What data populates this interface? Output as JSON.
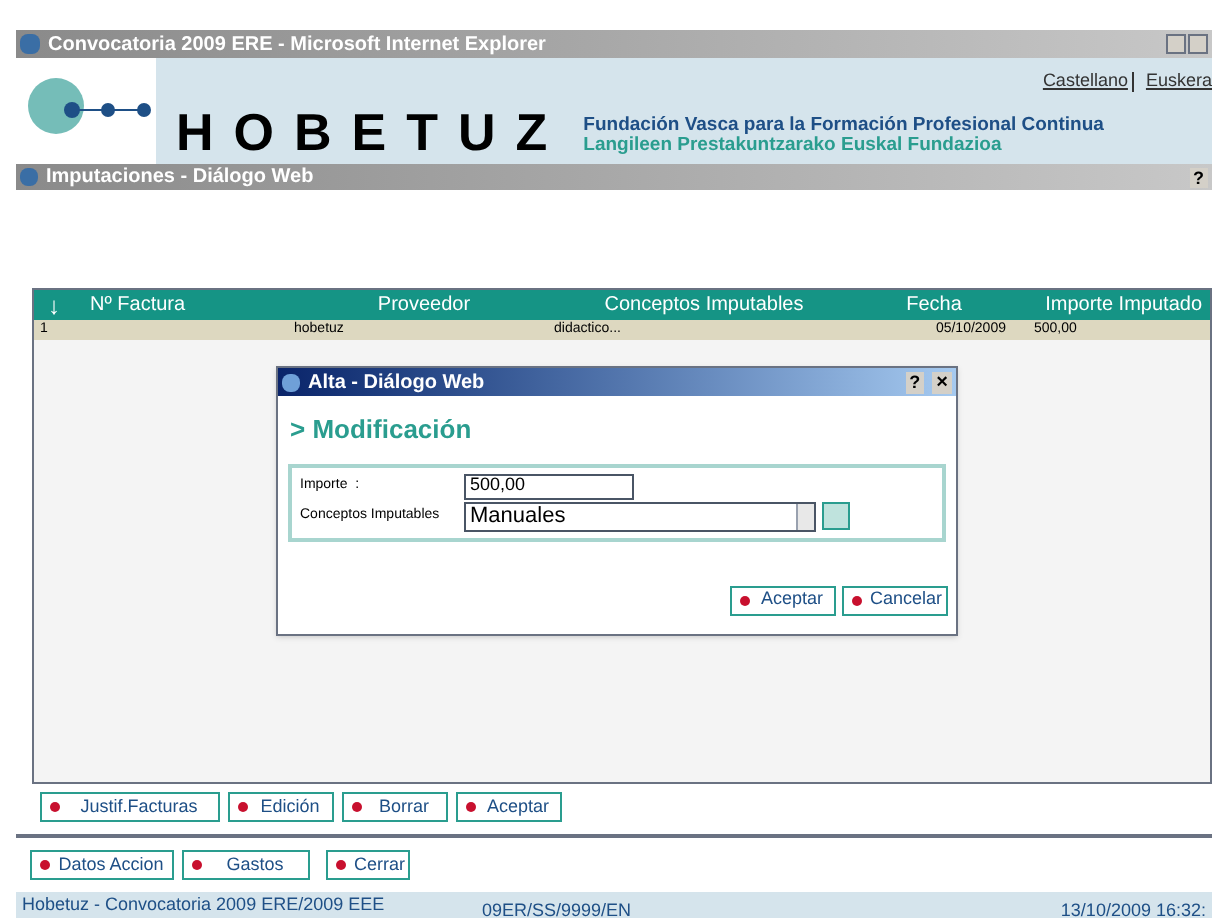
{
  "browser_window": {
    "title": "Convocatoria 2009 ERE - Microsoft Internet Explorer"
  },
  "header": {
    "languages": [
      "Castellano",
      "Euskera"
    ],
    "logo_text": "HOBETUZ",
    "tagline_es": "Fundación Vasca para la Formación Profesional Continua",
    "tagline_eu": "Langileen Prestakuntzarako Euskal Fundazioa"
  },
  "dialog_window": {
    "title": "Imputaciones - Diálogo Web",
    "help": "?"
  },
  "table": {
    "sort_icon": "↓",
    "columns": [
      "Nº Factura",
      "Proveedor",
      "Conceptos Imputables",
      "Fecha",
      "Importe Imputado"
    ],
    "rows": [
      {
        "cells": [
          "1",
          "hobetuz",
          "didactico...",
          "05/10/2009",
          "500,00"
        ],
        "selected": true
      }
    ]
  },
  "modal": {
    "title": "Alta - Diálogo Web",
    "help": "?",
    "close": "×",
    "heading": "> Modificación",
    "fields": [
      {
        "kind": "text",
        "label": "Importe  :",
        "value": "500,00"
      },
      {
        "kind": "spinner",
        "label": "Conceptos Imputables",
        "value": "Manuales"
      }
    ],
    "buttons": [
      "Aceptar",
      "Cancelar"
    ]
  },
  "table_buttons": [
    "Justif.Facturas",
    "Edición",
    "Borrar",
    "Aceptar"
  ],
  "nav_buttons": [
    "Datos Accion",
    "Gastos",
    "Cerrar"
  ],
  "status_bar": {
    "left": "Hobetuz - Convocatoria 2009 ERE/2009 EEE",
    "center": "09ER/SS/9999/EN",
    "right": "13/10/2009 16:32:"
  }
}
